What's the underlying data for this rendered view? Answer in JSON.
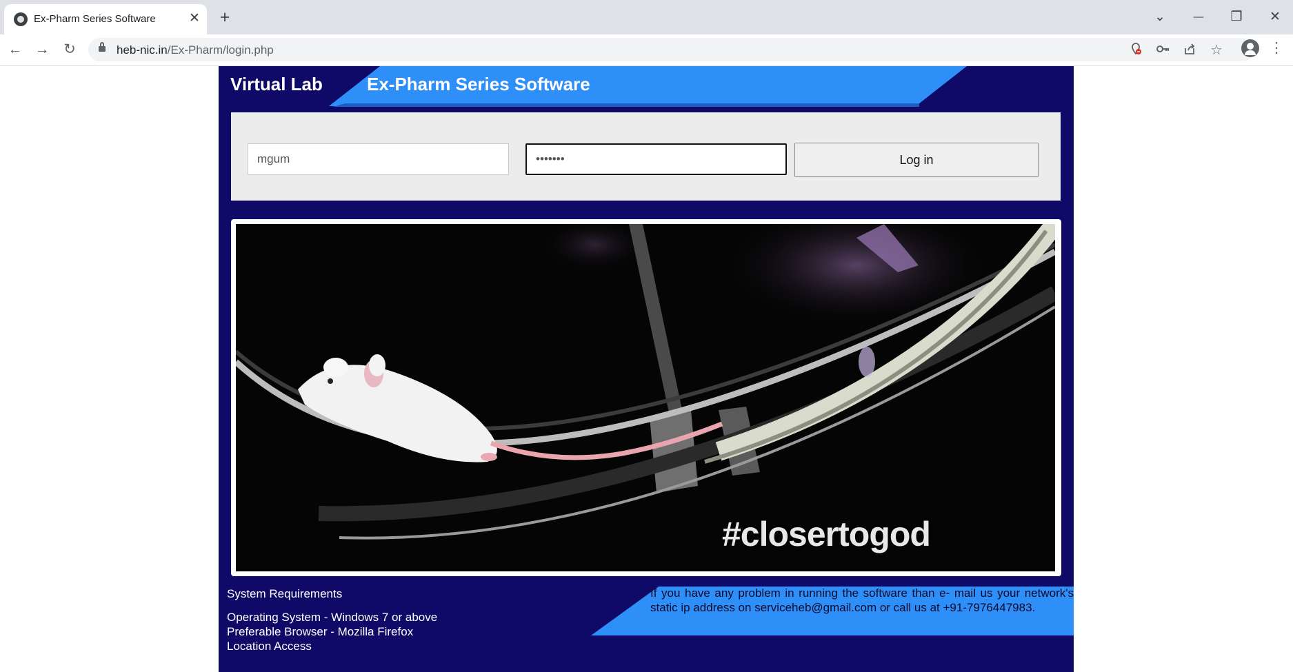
{
  "browser": {
    "tab_title": "Ex-Pharm Series Software",
    "url_host": "heb-nic.in",
    "url_path": "/Ex-Pharm/login.php",
    "icons": {
      "close": "✕",
      "new_tab": "+",
      "tab_list": "⌄",
      "minimize": "—",
      "restore": "❐",
      "close_window": "✕",
      "back": "←",
      "forward": "→",
      "reload": "↻",
      "menu": "⋮"
    }
  },
  "header": {
    "brand": "Virtual Lab",
    "title": "Ex-Pharm Series Software",
    "accent_color": "#2f8ff9",
    "background_color": "#0f0a68"
  },
  "login": {
    "username_value": "mgum",
    "password_value": "•••••••",
    "submit_label": "Log in"
  },
  "banner": {
    "hashtag": "#closertogod"
  },
  "requirements": {
    "title": "System Requirements",
    "lines": [
      "Operating System - Windows 7 or above",
      "Preferable Browser - Mozilla Firefox",
      "Location Access"
    ]
  },
  "support": {
    "text": "If you have any problem in running the software than e- mail us your network's static ip address on serviceheb@gmail.com or call us at +91-7976447983."
  }
}
